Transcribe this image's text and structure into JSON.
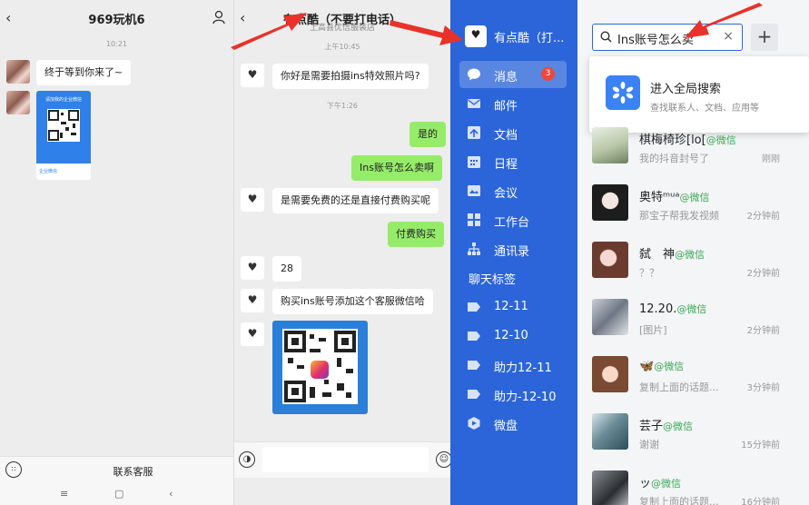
{
  "colors": {
    "sidebar": "#2b65d9",
    "bubble_green": "#95ec69",
    "badge_red": "#f0473a",
    "wechat_green": "#3aa856",
    "arrow_red": "#e8322a"
  },
  "p1": {
    "title": "969玩机6",
    "time": "10:21",
    "msg1": "终于等到你来了~",
    "qr_caption": "请加我的企业微信",
    "qr_brand": "企业微信",
    "bottom_label": "联系客服"
  },
  "p2": {
    "title": "有点酷（不要打电话）",
    "subtitle": "上高县优信服装店",
    "time1": "上午10:45",
    "time2": "下午1:26",
    "messages": [
      "你好是需要拍摄ins特效照片吗?",
      "是的",
      "Ins账号怎么卖啊",
      "是需要免费的还是直接付费购买呢",
      "付费购买",
      "28",
      "购买ins账号添加这个客服微信哈"
    ]
  },
  "p3": {
    "me_name": "有点酷（打...",
    "nav": {
      "messages": "消息",
      "badge": "3",
      "mail": "邮件",
      "docs": "文档",
      "calendar": "日程",
      "meeting": "会议",
      "workbench": "工作台",
      "contacts": "通讯录",
      "tags_header": "聊天标签",
      "tag1": "12-11",
      "tag2": "12-10",
      "tag3": "助力12-11",
      "tag4": "助力-12-10",
      "weidisk": "微盘"
    },
    "search": {
      "value": "Ins账号怎么卖",
      "clear": "×",
      "plus": "+"
    },
    "dropdown": {
      "title": "进入全局搜索",
      "subtitle": "查找联系人、文档、应用等"
    },
    "contacts": [
      {
        "name": "棋梅椅珍[lo[",
        "tag": "@微信",
        "preview": "我的抖音封号了",
        "time": "刚刚"
      },
      {
        "name": "奥特ᵐᵘᵃ",
        "tag": "@微信",
        "preview": "那宝子帮我发视频",
        "time": "2分钟前"
      },
      {
        "name": "弑　神",
        "tag": "@微信",
        "preview": "？？",
        "time": "2分钟前"
      },
      {
        "name": "12.20.",
        "tag": "@微信",
        "preview": "[图片]",
        "time": "2分钟前"
      },
      {
        "name": "🦋",
        "tag": "@微信",
        "preview": "复制上面的话题...",
        "time": "3分钟前"
      },
      {
        "name": "芸子",
        "tag": "@微信",
        "preview": "谢谢",
        "time": "15分钟前"
      },
      {
        "name": "ッ",
        "tag": "@微信",
        "preview": "复制上面的话题...",
        "time": "16分钟前"
      }
    ]
  }
}
